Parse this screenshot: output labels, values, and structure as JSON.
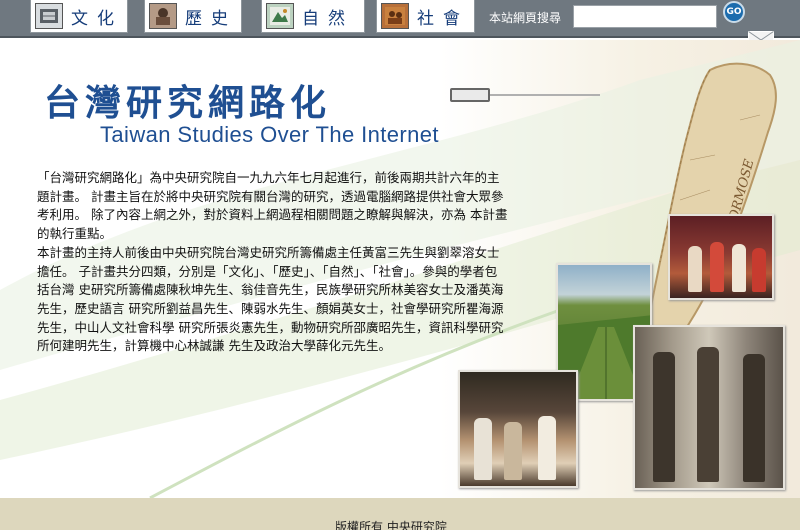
{
  "nav": {
    "tabs": [
      {
        "label": "文化",
        "icon": "culture-thumbnail-icon"
      },
      {
        "label": "歷史",
        "icon": "history-thumbnail-icon"
      },
      {
        "label": "自然",
        "icon": "nature-thumbnail-icon"
      },
      {
        "label": "社會",
        "icon": "society-thumbnail-icon"
      }
    ],
    "search": {
      "label": "本站網頁搜尋",
      "value": "",
      "placeholder": "",
      "go_label": "GO"
    }
  },
  "banner": {
    "title_zh": "台灣研究網路化",
    "title_en": "Taiwan Studies Over The Internet",
    "map_label": "FORMOSE"
  },
  "description": {
    "paragraph1": "「台灣研究網路化」為中央研究院自一九九六年七月起進行，前後兩期共計六年的主題計畫。 計畫主旨在於將中央研究院有關台灣的研究，透過電腦網路提供社會大眾參考利用。 除了內容上網之外，對於資料上網過程相關問題之瞭解與解決，亦為 本計畫的執行重點。",
    "paragraph2": "本計畫的主持人前後由中央研究院台灣史研究所籌備處主任黃富三先生與劉翠溶女士擔任。 子計畫共分四類，分別是「文化」、「歷史」、「自然」、「社會」。參與的學者包括台灣 史研究所籌備處陳秋坤先生、翁佳音先生，民族學研究所林美容女士及潘英海先生，歷史語言 研究所劉益昌先生、陳弱水先生、顏娟英女士，社會學研究所瞿海源先生，中山人文社會科學 研究所張炎憲先生，動物研究所邵廣昭先生，資訊科學研究所何建明先生，計算機中心林誠謙 先生及政治大學薛化元先生。"
  },
  "footer": {
    "copyright": "版權所有 中央研究院"
  },
  "colors": {
    "topbar": "#6f7880",
    "title": "#1f4f92",
    "footer": "#ddd7bd"
  }
}
